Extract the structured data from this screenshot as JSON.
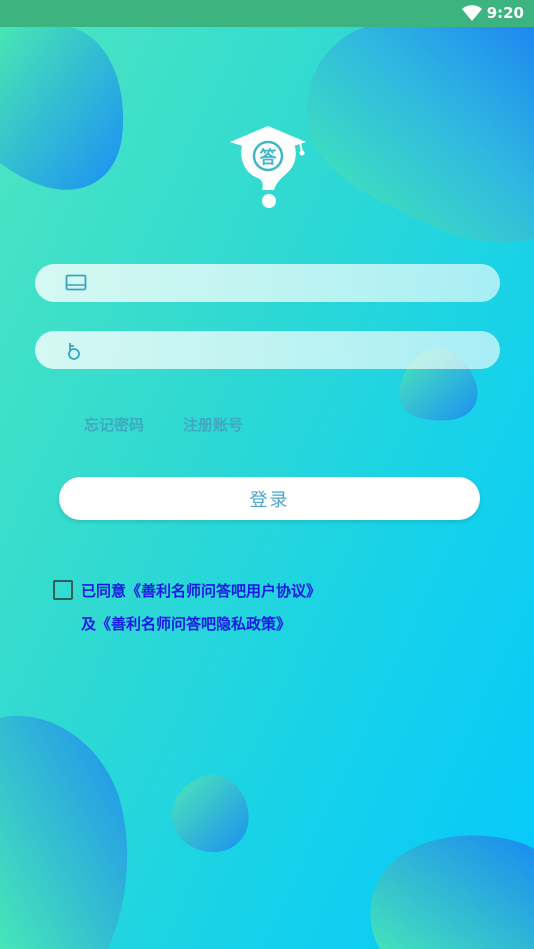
{
  "status_bar": {
    "time": "9:20",
    "wifi_icon": "wifi-icon"
  },
  "logo": {
    "glyph": "答",
    "icon": "graduation-cap-question-icon"
  },
  "form": {
    "username_icon": "tablet-icon",
    "username_placeholder": "",
    "password_icon": "key-icon",
    "password_placeholder": ""
  },
  "links": {
    "forgot_password": "忘记密码",
    "register": "注册账号"
  },
  "login_button": "登录",
  "agreement": {
    "line1": "已同意《善利名师问答吧用户协议》",
    "line2": "及《善利名师问答吧隐私政策》",
    "checked": false
  },
  "colors": {
    "status_bar": "#3db480",
    "link": "#3fa9c2",
    "agreement_text": "#1a1ae6"
  }
}
